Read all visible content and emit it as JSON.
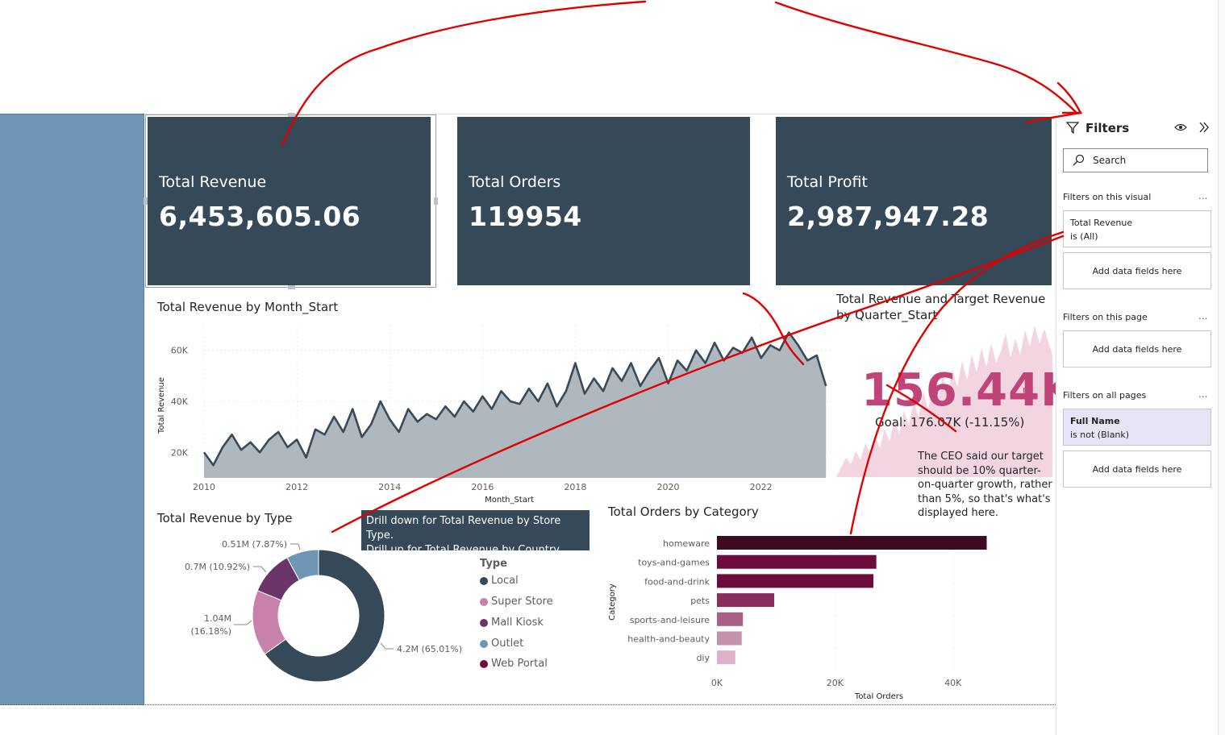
{
  "kpis": {
    "revenue": {
      "label": "Total Revenue",
      "value": "6,453,605.06"
    },
    "orders": {
      "label": "Total Orders",
      "value": "119954"
    },
    "profit": {
      "label": "Total Profit",
      "value": "2,987,947.28"
    }
  },
  "line_chart": {
    "title": "Total Revenue by Month_Start",
    "y_ticks": [
      "60K",
      "40K",
      "20K"
    ],
    "x_ticks": [
      "2010",
      "2012",
      "2014",
      "2016",
      "2018",
      "2020",
      "2022"
    ],
    "ylabel": "Total Revenue",
    "xlabel": "Month_Start"
  },
  "donut_chart": {
    "title": "Total Revenue by Type",
    "labels": [
      "0.51M (7.87%)",
      "0.7M (10.92%)",
      "1.04M",
      "(16.18%)",
      "4.2M (65.01%)"
    ],
    "legend_title": "Type",
    "legend": [
      "Local",
      "Super Store",
      "Mall Kiosk",
      "Outlet",
      "Web Portal"
    ]
  },
  "tooltip": {
    "line1": "Drill down for Total Revenue by Store Type.",
    "line2": "Drill up for Total Revenue by Country."
  },
  "bar_chart": {
    "title": "Total Orders by Category",
    "ylabel": "Category",
    "xlabel": "Total Orders",
    "x_ticks": [
      "0K",
      "20K",
      "40K"
    ]
  },
  "kpi_goal": {
    "title_line1": "Total Revenue and Target Revenue",
    "title_line2": "by Quarter_Start",
    "value": "156.44K",
    "excl": "!",
    "goal": "Goal: 176.07K (-11.15%)",
    "note": "The CEO said our target should be 10% quarter-on-quarter growth, rather than 5%, so that's what's displayed here."
  },
  "filters": {
    "title": "Filters",
    "search_placeholder": "Search",
    "on_visual": "Filters on this visual",
    "visual_field": "Total Revenue",
    "visual_field_state": "is (All)",
    "add_fields": "Add data fields here",
    "on_page": "Filters on this page",
    "on_all_pages": "Filters on all pages",
    "all_field": "Full Name",
    "all_field_state": "is not (Blank)",
    "more": "..."
  },
  "colors": {
    "kpi_bg": "#354959",
    "sidebar": "#6f96b5",
    "line": "#3a4a56",
    "area": "#b0b8bf",
    "annotation": "#e00000",
    "goal": "#c0437a"
  },
  "chart_data": [
    {
      "type": "area",
      "title": "Total Revenue by Month_Start",
      "xlabel": "Month_Start",
      "ylabel": "Total Revenue",
      "xlim": [
        2010,
        2023.5
      ],
      "ylim": [
        10000,
        70000
      ],
      "x": [
        2010.0,
        2010.2,
        2010.4,
        2010.6,
        2010.8,
        2011.0,
        2011.2,
        2011.4,
        2011.6,
        2011.8,
        2012.0,
        2012.2,
        2012.4,
        2012.6,
        2012.8,
        2013.0,
        2013.2,
        2013.4,
        2013.6,
        2013.8,
        2014.0,
        2014.2,
        2014.4,
        2014.6,
        2014.8,
        2015.0,
        2015.2,
        2015.4,
        2015.6,
        2015.8,
        2016.0,
        2016.2,
        2016.4,
        2016.6,
        2016.8,
        2017.0,
        2017.2,
        2017.4,
        2017.6,
        2017.8,
        2018.0,
        2018.2,
        2018.4,
        2018.6,
        2018.8,
        2019.0,
        2019.2,
        2019.4,
        2019.6,
        2019.8,
        2020.0,
        2020.2,
        2020.4,
        2020.6,
        2020.8,
        2021.0,
        2021.2,
        2021.4,
        2021.6,
        2021.8,
        2022.0,
        2022.2,
        2022.4,
        2022.6,
        2022.8,
        2023.0,
        2023.2,
        2023.4
      ],
      "y": [
        20000,
        15000,
        22000,
        27000,
        21000,
        24000,
        20000,
        25000,
        28000,
        22000,
        25000,
        18000,
        29000,
        27000,
        34000,
        28000,
        37000,
        26000,
        31000,
        40000,
        33000,
        28000,
        37000,
        32000,
        35000,
        33000,
        38000,
        34000,
        40000,
        36000,
        42000,
        37000,
        44000,
        40000,
        39000,
        45000,
        40000,
        47000,
        38000,
        44000,
        55000,
        43000,
        49000,
        44000,
        53000,
        48000,
        55000,
        46000,
        52000,
        57000,
        47000,
        56000,
        52000,
        60000,
        55000,
        63000,
        56000,
        61000,
        59000,
        65000,
        57000,
        62000,
        60000,
        67000,
        62000,
        56000,
        58000,
        46000
      ]
    },
    {
      "type": "pie",
      "title": "Total Revenue by Type",
      "labels": [
        "Local",
        "Super Store",
        "Mall Kiosk",
        "Outlet",
        "Web Portal"
      ],
      "values": [
        4.2,
        1.04,
        0.7,
        0.51,
        0.0
      ],
      "percent": [
        65.01,
        16.18,
        10.92,
        7.87,
        0.0
      ],
      "colors": [
        "#354959",
        "#c882aa",
        "#6b3569",
        "#6f96b5",
        "#6b0c3c"
      ]
    },
    {
      "type": "bar",
      "orientation": "horizontal",
      "title": "Total Orders by Category",
      "xlabel": "Total Orders",
      "ylabel": "Category",
      "categories": [
        "homeware",
        "toys-and-games",
        "food-and-drink",
        "pets",
        "sports-and-leisure",
        "health-and-beauty",
        "diy"
      ],
      "values": [
        45700,
        27000,
        26500,
        9700,
        4400,
        4200,
        3100
      ],
      "xlim": [
        0,
        50000
      ],
      "colors": [
        "#3d0a22",
        "#6b0c3c",
        "#6b0c3c",
        "#8a2f5c",
        "#a95f86",
        "#c492ad",
        "#e0b2c9"
      ]
    }
  ]
}
